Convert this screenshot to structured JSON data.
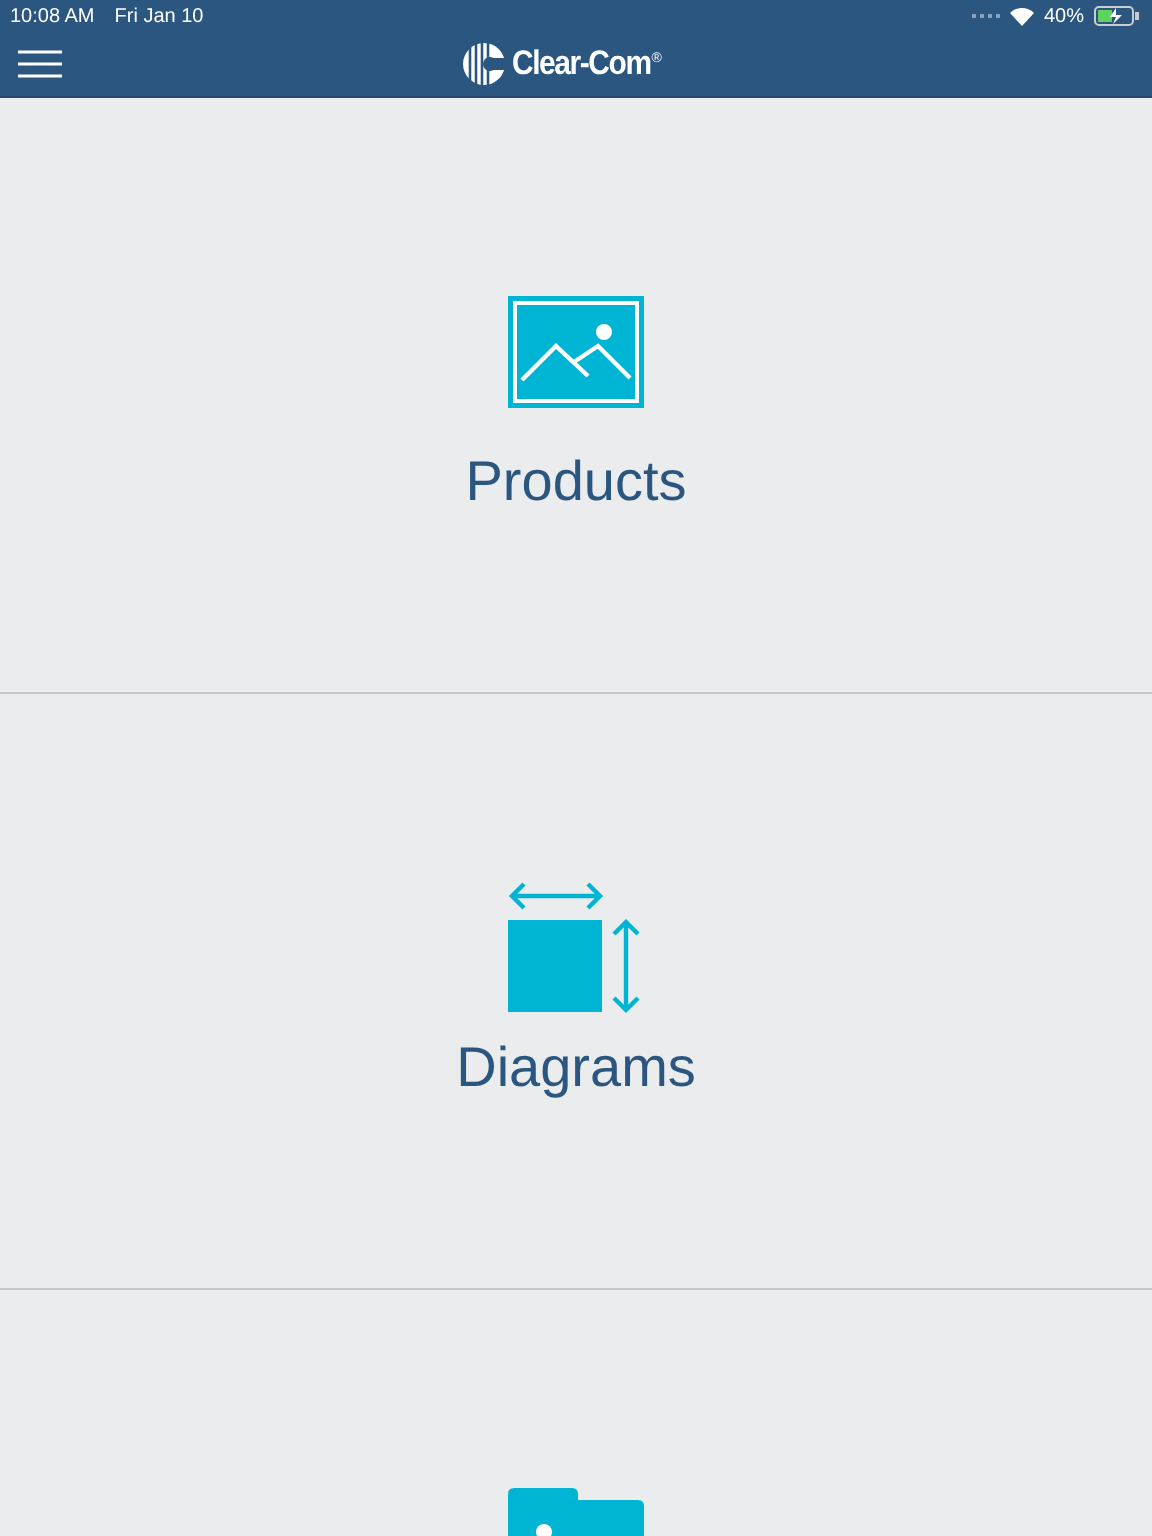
{
  "status_bar": {
    "time": "10:08 AM",
    "date": "Fri Jan 10",
    "battery": "40%"
  },
  "nav_bar": {
    "logo_text": "Clear-Com",
    "logo_mark": "®"
  },
  "sections": [
    {
      "kind": "picture",
      "label": "Products"
    },
    {
      "kind": "diagram",
      "label": "Diagrams"
    },
    {
      "kind": "folder"
    }
  ]
}
